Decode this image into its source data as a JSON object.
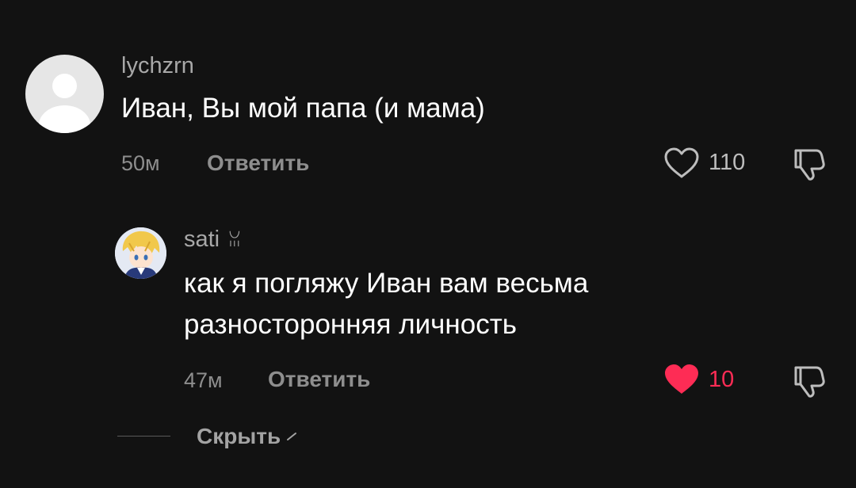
{
  "comments": [
    {
      "username": "lychzrn",
      "text": "Иван, Вы мой папа (и мама)",
      "time": "50м",
      "reply_label": "Ответить",
      "like_count": "110",
      "liked": false,
      "like_icon": "heart-outline-icon",
      "dislike_icon": "thumbs-down-icon"
    },
    {
      "username": "sati",
      "username_badge": "ꈍ",
      "text_line1": "как я погляжу Иван вам весьма",
      "text_line2": "разносторонняя личность",
      "time": "47м",
      "reply_label": "Ответить",
      "like_count": "10",
      "liked": true,
      "like_color": "#fe2c55",
      "like_icon": "heart-filled-icon",
      "dislike_icon": "thumbs-down-icon"
    }
  ],
  "replies_toggle": {
    "hide_label": "Скрыть",
    "icon": "chevron-up-icon"
  },
  "colors": {
    "background": "#121212",
    "text_primary": "#ffffff",
    "text_secondary": "#8e8e8e",
    "accent_like": "#fe2c55"
  }
}
